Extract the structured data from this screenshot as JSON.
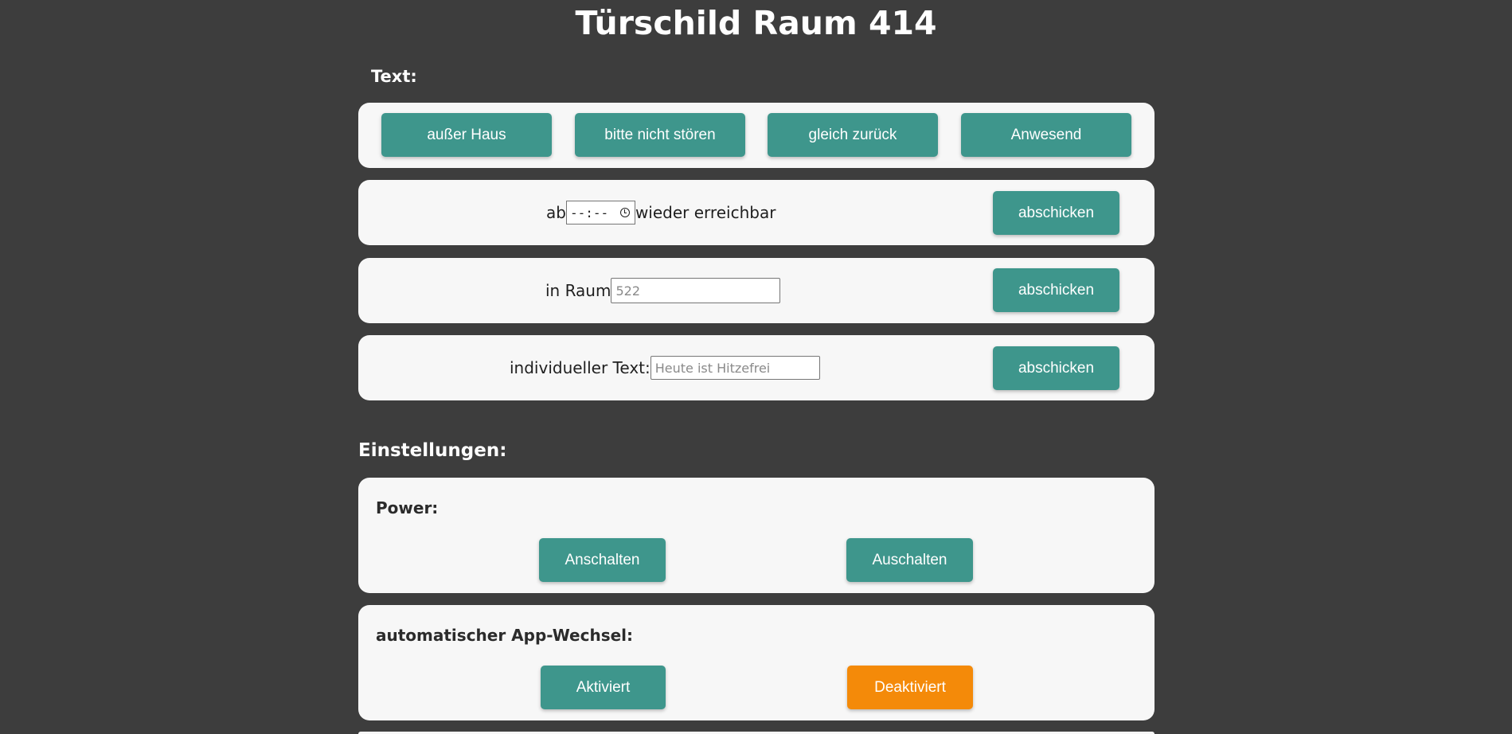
{
  "header": {
    "title": "Türschild Raum 414"
  },
  "text_section": {
    "label": "Text:",
    "quick_buttons": [
      "außer Haus",
      "bitte nicht stören",
      "gleich zurück",
      "Anwesend"
    ],
    "time_row": {
      "prefix": "ab",
      "time_value": "--:--",
      "suffix": "wieder erreichbar",
      "button": "abschicken"
    },
    "room_row": {
      "label": "in Raum",
      "placeholder": "522",
      "button": "abschicken"
    },
    "custom_row": {
      "label": "individueller Text:",
      "placeholder": "Heute ist Hitzefrei",
      "button": "abschicken"
    }
  },
  "settings_section": {
    "label": "Einstellungen:",
    "power": {
      "label": "Power:",
      "on_button": "Anschalten",
      "off_button": "Auschalten"
    },
    "app_switch": {
      "label": "automatischer App-Wechsel:",
      "activate_button": "Aktiviert",
      "deactivate_button": "Deaktiviert",
      "selected": "Deaktiviert",
      "selected_color": "#f48a09"
    }
  },
  "colors": {
    "background": "#3d3d3d",
    "card": "#f7f7f7",
    "button": "#3e968c",
    "button_active": "#f48a09"
  }
}
